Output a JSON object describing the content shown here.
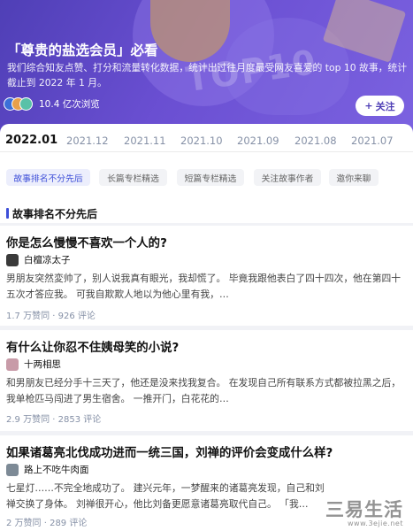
{
  "banner": {
    "title": "「尊贵的盐选会员」必看",
    "description": "我们综合知友点赞、打分和流量转化数据，统计出过往月度最受网友喜爱的 top 10 故事，统计截止到 2022 年 1 月。",
    "views": "10.4 亿次浏览",
    "follow_label": "关注",
    "follow_icon": "plus-icon",
    "deco_text": "TOP10",
    "colors": {
      "background": "#5a47c8",
      "accent": "#3d4ed8"
    }
  },
  "tabs": [
    "2022.01",
    "2021.12",
    "2021.11",
    "2021.10",
    "2021.09",
    "2021.08",
    "2021.07"
  ],
  "chips": [
    "故事排名不分先后",
    "长篇专栏精选",
    "短篇专栏精选",
    "关注故事作者",
    "邀你来聊"
  ],
  "section_title": "故事排名不分先后",
  "stories": [
    {
      "title": "你是怎么慢慢不喜欢一个人的?",
      "author": "白檀凉太子",
      "excerpt": "男朋友突然変帅了，别人说我真有眼光，我却慌了。 毕竟我跟他表白了四十四次，他在第四十五次才答应我。 可我自欺欺人地以为他心里有我，…",
      "meta": "1.7 万赞同 · 926 评论"
    },
    {
      "title": "有什么让你忍不住姨母笑的小说?",
      "author": "十两相思",
      "excerpt": "和男朋友已经分手十三天了，他还是没来找我复合。 在发现自己所有联系方式都被拉黑之后，我单枪匹马闯进了男生宿舍。 一推开门，白花花的…",
      "meta": "2.9 万赞同 · 2853 评论"
    },
    {
      "title": "如果诸葛亮北伐成功进而一统三国，刘禅的评价会变成什么样?",
      "author": "路上不吃牛肉面",
      "excerpt": "七星灯……不完全地成功了。 建兴元年，一梦醒来的诸葛亮发现，自己和刘禅交换了身体。 刘禅很开心，他比刘备更愿意诸葛亮取代自己。 「我…",
      "meta": "2 万赞同 · 289 评论"
    }
  ],
  "watermark": {
    "main": "三易生活",
    "sub": "www.3ejie.net"
  }
}
